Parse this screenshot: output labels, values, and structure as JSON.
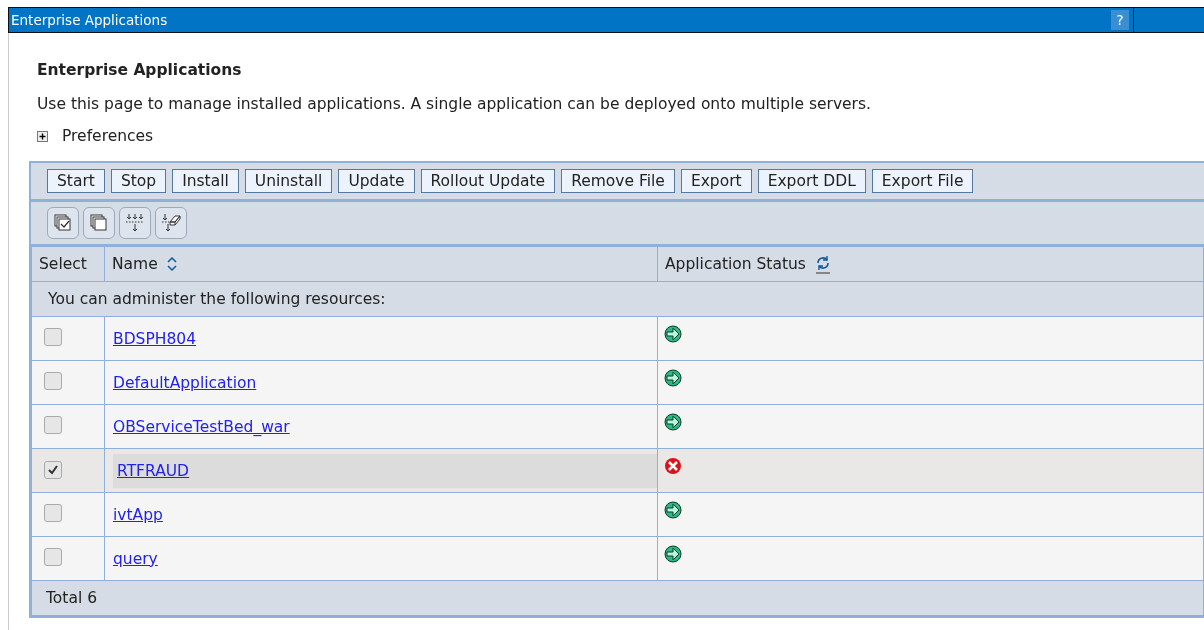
{
  "window": {
    "title": "Enterprise Applications",
    "help": "?"
  },
  "heading": "Enterprise Applications",
  "description": "Use this page to manage installed applications. A single application can be deployed onto multiple servers.",
  "preferences": {
    "label": "Preferences",
    "expanded": false
  },
  "buttons": [
    "Start",
    "Stop",
    "Install",
    "Uninstall",
    "Update",
    "Rollout Update",
    "Remove File",
    "Export",
    "Export DDL",
    "Export File"
  ],
  "table": {
    "columns": [
      "Select",
      "Name",
      "Application Status"
    ],
    "group_label": "You can administer the following resources:",
    "rows": [
      {
        "name": "BDSPH804",
        "checked": false,
        "kind": "started"
      },
      {
        "name": "DefaultApplication",
        "checked": false,
        "kind": "started"
      },
      {
        "name": "OBServiceTestBed_war",
        "checked": false,
        "kind": "started"
      },
      {
        "name": "RTFRAUD",
        "checked": true,
        "kind": "stopped"
      },
      {
        "name": "ivtApp",
        "checked": false,
        "kind": "started"
      },
      {
        "name": "query",
        "checked": false,
        "kind": "started"
      }
    ],
    "total": "Total 6"
  }
}
